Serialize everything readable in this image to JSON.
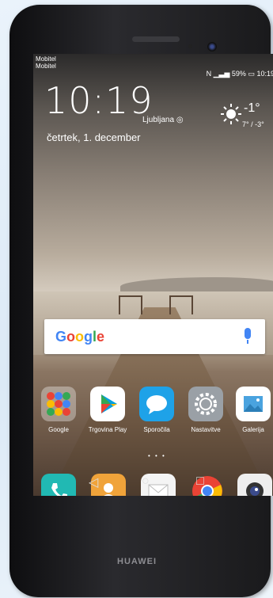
{
  "status_bar": {
    "carrier_line1": "Mobitel",
    "carrier_line2": "Mobitel",
    "battery": "59%",
    "time": "10:19"
  },
  "lockscreen": {
    "clock": "10:19",
    "city": "Ljubljana",
    "date": "četrtek, 1. december",
    "weather": {
      "temp": "-1°",
      "range": "7° / -3°",
      "icon": "sun-icon"
    }
  },
  "search_bar": {
    "logo": "Google",
    "icon": "mic-icon"
  },
  "apps": [
    {
      "label": "Google",
      "icon": "google-folder-icon"
    },
    {
      "label": "Trgovina Play",
      "icon": "play-store-icon"
    },
    {
      "label": "Sporočila",
      "icon": "messages-icon"
    },
    {
      "label": "Nastavitve",
      "icon": "settings-icon"
    },
    {
      "label": "Galerija",
      "icon": "gallery-icon"
    }
  ],
  "dock": [
    "phone-icon",
    "contacts-icon",
    "email-icon",
    "chrome-icon",
    "camera-icon"
  ],
  "nav": {
    "back": "◁",
    "home": "○",
    "recents": "□"
  },
  "brand": "HUAWEI",
  "colors": {
    "google_blue": "#4285f4",
    "messages": "#1ea2e8",
    "phone": "#21b9b3",
    "contacts": "#f0a33a"
  }
}
